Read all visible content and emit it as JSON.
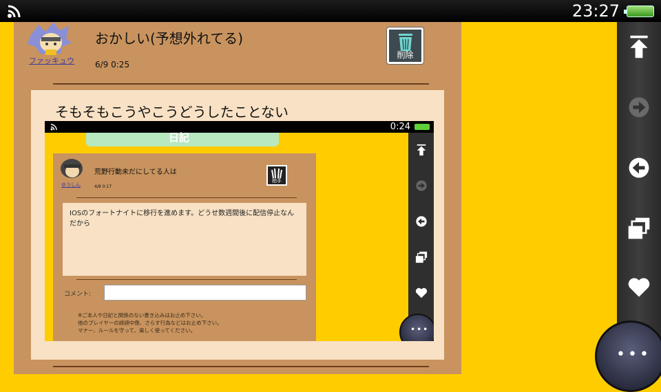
{
  "status": {
    "time": "23:27"
  },
  "post": {
    "poster_name": "ファッキュウ",
    "title": "おかしい(予想外れてる)",
    "date": "6/9 0:25",
    "delete_label": "削除"
  },
  "comment": {
    "text": "そもそもこうやこうどうしたことない"
  },
  "shot": {
    "time": "0:24",
    "banner_text": "日記",
    "poster_name": "ゆうしん",
    "title": "荒野行動未だにしてる人は",
    "date": "4/8 0:17",
    "clap_label": "拍手",
    "body": "IOSのフォートナイトに移行を進めます。どうせ数週間後に配信停止なんだから",
    "comment_label": "コメント:",
    "notes": [
      "※ご本人や日記と関係のない書き込みはお止め下さい。",
      "他のプレイヤーの誹謗中傷、さらす行為などはお止め下さい。",
      "マナー、ルールを守って、楽しく使ってください。"
    ]
  },
  "rightbar": {
    "icons": [
      "scroll-top-icon",
      "forward-icon",
      "back-icon",
      "windows-icon",
      "heart-icon"
    ],
    "more_label": "•••"
  },
  "colors": {
    "background": "#ffcc00",
    "content": "#c8935e",
    "panel": "#f8e1c4"
  }
}
